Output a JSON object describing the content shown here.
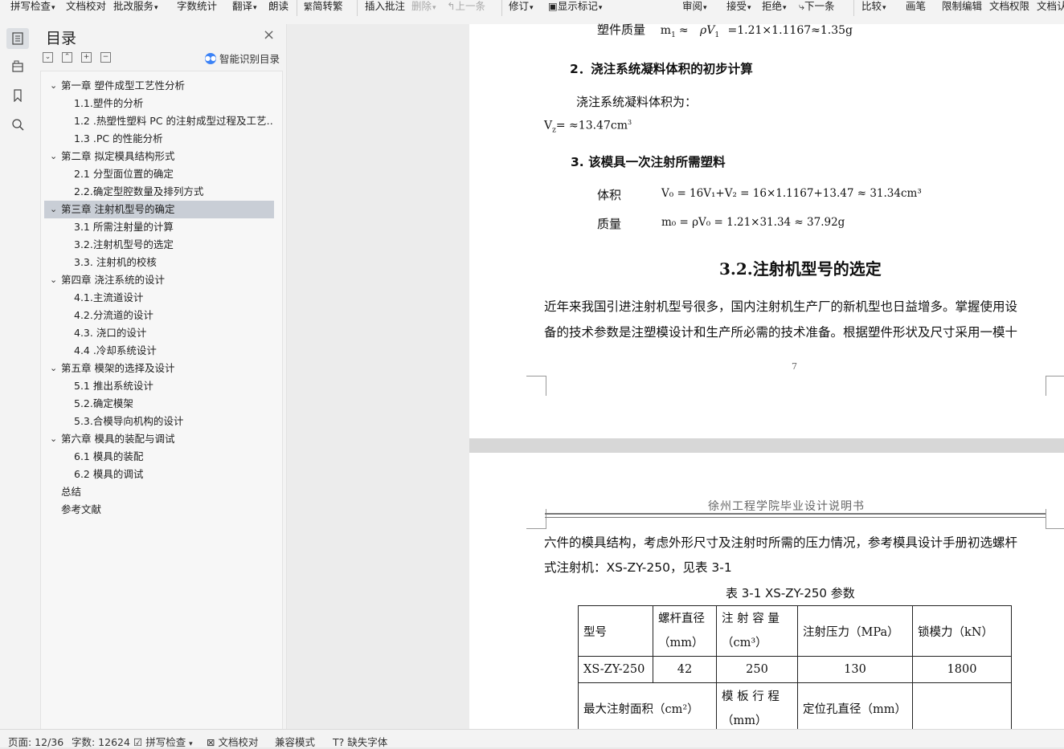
{
  "toolbar": {
    "spell_check": "拼写检查",
    "doc_proof": "文档校对",
    "revise_service": "批改服务",
    "word_count": "字数统计",
    "translate": "翻译",
    "read_aloud": "朗读",
    "trad_convert": "简转繁",
    "insert_comment": "插入批注",
    "delete": "删除",
    "prev": "上一条",
    "track": "修订",
    "show_marks": "显示标记",
    "review": "审阅",
    "accept": "接受",
    "reject": "拒绝",
    "next": "下一条",
    "compare": "比较",
    "pen": "画笔",
    "restrict_edit": "限制编辑",
    "doc_permission": "文档权限",
    "doc_cert": "文档认"
  },
  "toc": {
    "title": "目录",
    "smart_label": "智能识别目录",
    "items": [
      {
        "level": 1,
        "text": "第一章   塑件成型工艺性分析",
        "collapsible": true
      },
      {
        "level": 2,
        "text": "1.1.塑件的分析"
      },
      {
        "level": 2,
        "text": "1.2 .热塑性塑料 PC 的注射成型过程及工艺…"
      },
      {
        "level": 2,
        "text": "1.3 .PC 的性能分析"
      },
      {
        "level": 1,
        "text": "第二章   拟定模具结构形式",
        "collapsible": true
      },
      {
        "level": 2,
        "text": "2.1 分型面位置的确定"
      },
      {
        "level": 2,
        "text": "2.2.确定型腔数量及排列方式"
      },
      {
        "level": 1,
        "text": "第三章   注射机型号的确定",
        "collapsible": true,
        "selected": true
      },
      {
        "level": 2,
        "text": "3.1 所需注射量的计算"
      },
      {
        "level": 2,
        "text": "3.2.注射机型号的选定"
      },
      {
        "level": 2,
        "text": "3.3. 注射机的校核"
      },
      {
        "level": 1,
        "text": "第四章   浇注系统的设计",
        "collapsible": true
      },
      {
        "level": 2,
        "text": "4.1.主流道设计"
      },
      {
        "level": 2,
        "text": "4.2.分流道的设计"
      },
      {
        "level": 2,
        "text": "4.3. 浇口的设计"
      },
      {
        "level": 2,
        "text": "4.4 .冷却系统设计"
      },
      {
        "level": 1,
        "text": "第五章  模架的选择及设计",
        "collapsible": true
      },
      {
        "level": 2,
        "text": "5.1  推出系统设计"
      },
      {
        "level": 2,
        "text": "5.2.确定模架"
      },
      {
        "level": 2,
        "text": "5.3.合模导向机构的设计"
      },
      {
        "level": 1,
        "text": "第六章  模具的装配与调试",
        "collapsible": true
      },
      {
        "level": 2,
        "text": "6.1  模具的装配"
      },
      {
        "level": 2,
        "text": "6.2  模具的调试"
      },
      {
        "level": 1,
        "text": "总结",
        "collapsible": false
      },
      {
        "level": 1,
        "text": "参考文献",
        "collapsible": false
      }
    ]
  },
  "page1": {
    "mass_label": "塑件质量",
    "mass_formula_a": "m",
    "mass_sub_a": "1",
    "mass_approx": "≈",
    "rho_v": "ρV",
    "rho_sub": "1",
    "mass_formula_b": "=1.21×1.1167≈1.35g",
    "heading2": "2．浇注系统凝料体积的初步计算",
    "vol_intro": "浇注系统凝料体积为：",
    "vol_formula_a": "V",
    "vol_sub": "z",
    "vol_formula_b": "= ≈13.47cm",
    "vol_sup": "3",
    "heading3": "3.   该模具一次注射所需塑料",
    "volume_label": "体积",
    "volume_formula": "V₀ = 16V₁+V₂ = 16×1.1167+13.47 ≈ 31.34cm³",
    "massb_label": "质量",
    "massb_formula": "m₀ =  ρV₀ = 1.21×31.34 ≈ 37.92g",
    "section_title": "3.2.注射机型号的选定",
    "para_line1": "近年来我国引进注射机型号很多，国内注射机生产厂的新机型也日益增多。掌握使用设",
    "para_line2": "备的技术参数是注塑模设计和生产所必需的技术准备。根据塑件形状及尺寸采用一模十",
    "page_number": "7"
  },
  "page2": {
    "header": "徐州工程学院毕业设计说明书",
    "para_line1": "六件的模具结构，考虑外形尺寸及注射时所需的压力情况，参考模具设计手册初选螺杆",
    "para_line2": "式注射机：XS-ZY-250，见表 3-1",
    "table_caption": "表 3-1 XS-ZY-250 参数",
    "table": {
      "h_model": "型号",
      "h_screw_a": "螺杆直径",
      "h_screw_b": "（mm）",
      "h_cap_a": "注 射 容 量",
      "h_cap_b": "（cm³）",
      "h_pressure": "注射压力（MPa）",
      "h_clamp": "锁模力（kN）",
      "r_model": "XS-ZY-250",
      "r_screw": "42",
      "r_cap": "250",
      "r_pressure": "130",
      "r_clamp": "1800",
      "h_area": "最大注射面积（cm²）",
      "h_stroke_a": "模 板 行 程",
      "h_stroke_b": "（mm）",
      "h_hole": "定位孔直径（mm）"
    }
  },
  "status": {
    "page": "页面: 12/36",
    "words": "字数: 12624",
    "spell": "拼写检查",
    "proof": "文档校对",
    "compat": "兼容模式",
    "missing_font": "缺失字体"
  }
}
